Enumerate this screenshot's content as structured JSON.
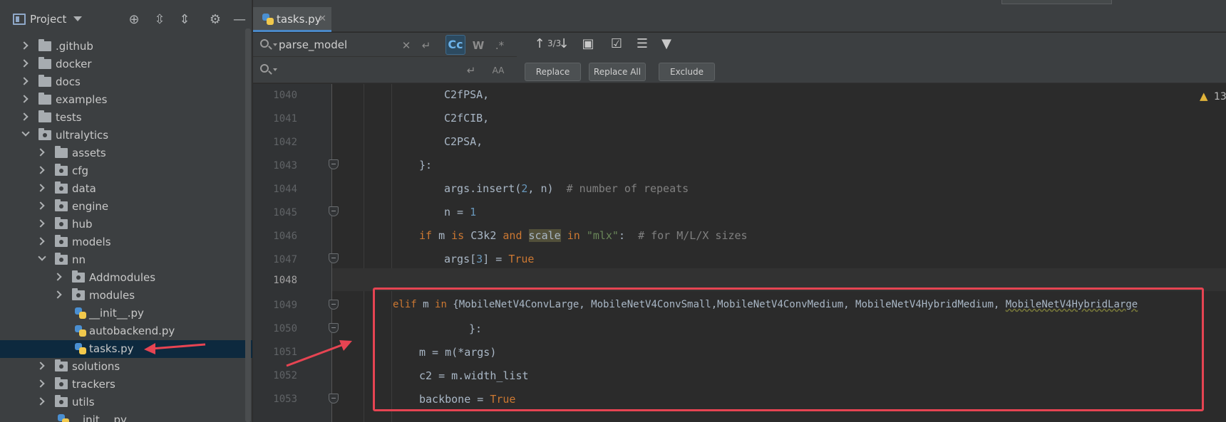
{
  "project_panel": {
    "title": "Project",
    "items": [
      {
        "label": ".github",
        "type": "folder"
      },
      {
        "label": "docker",
        "type": "folder"
      },
      {
        "label": "docs",
        "type": "folder"
      },
      {
        "label": "examples",
        "type": "folder"
      },
      {
        "label": "tests",
        "type": "folder"
      },
      {
        "label": "ultralytics",
        "type": "package"
      },
      {
        "label": "assets",
        "type": "folder"
      },
      {
        "label": "cfg",
        "type": "package"
      },
      {
        "label": "data",
        "type": "package"
      },
      {
        "label": "engine",
        "type": "package"
      },
      {
        "label": "hub",
        "type": "package"
      },
      {
        "label": "models",
        "type": "package"
      },
      {
        "label": "nn",
        "type": "package"
      },
      {
        "label": "Addmodules",
        "type": "package"
      },
      {
        "label": "modules",
        "type": "package"
      },
      {
        "label": "__init__.py",
        "type": "file"
      },
      {
        "label": "autobackend.py",
        "type": "file"
      },
      {
        "label": "tasks.py",
        "type": "file"
      },
      {
        "label": "solutions",
        "type": "package"
      },
      {
        "label": "trackers",
        "type": "package"
      },
      {
        "label": "utils",
        "type": "package"
      },
      {
        "label": "__init__.py",
        "type": "file"
      }
    ]
  },
  "editor": {
    "tab_label": "tasks.py",
    "search_value": "parse_model",
    "replace_value": "",
    "match_count": "3/3",
    "cc_label": "Cc",
    "w_label": "W",
    "regex_label": ".*",
    "buttons": {
      "replace": "Replace",
      "replace_all": "Replace All",
      "exclude": "Exclude"
    },
    "warning_count": "13",
    "line_numbers": [
      "1040",
      "1041",
      "1042",
      "1043",
      "1044",
      "1045",
      "1046",
      "1047",
      "1048",
      "1049",
      "1050",
      "1051",
      "1052",
      "1053"
    ]
  },
  "colors": {
    "accent": "#4a88c7",
    "annotation": "#e64452",
    "keyword": "#cc7832",
    "number": "#6897bb",
    "string": "#6a8759"
  }
}
